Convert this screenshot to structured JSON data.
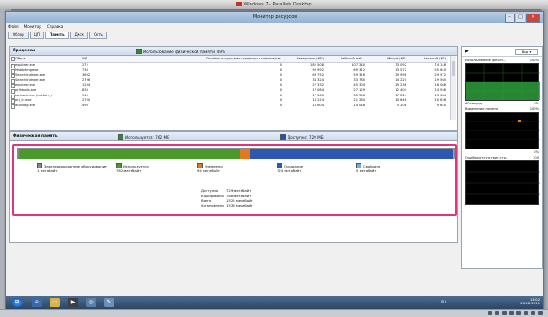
{
  "mac_title": "Windows 7 - Parallels Desktop",
  "window": {
    "title": "Монитор ресурсов",
    "menu": [
      "Файл",
      "Монитор",
      "Справка"
    ],
    "tabs": [
      "Обзор",
      "ЦП",
      "Память",
      "Диск",
      "Сеть"
    ],
    "active_tab": "Память"
  },
  "processes": {
    "title": "Процессы",
    "summary": "Использование физической памяти: 49%",
    "summary_color": "#2e8b2e",
    "columns": [
      "Образ",
      "ИД...",
      "Ошибок отсутствия страницы в памяти/сек.",
      "Завершено (КБ)",
      "Рабочий наб...",
      "Общий (КБ)",
      "Частный (КБ)"
    ],
    "rows": [
      {
        "name": "explorer.exe",
        "pid": "272",
        "hf": "0",
        "commit": "182 508",
        "ws": "107 240",
        "share": "33 092",
        "priv": "74 148"
      },
      {
        "name": "Msbfpfmg.exe",
        "pid": "736",
        "hf": "0",
        "commit": "99 992",
        "ws": "69 312",
        "share": "13 572",
        "priv": "55 640"
      },
      {
        "name": "SearchIndexer.exe",
        "pid": "3692",
        "hf": "0",
        "commit": "69 752",
        "ws": "59 316",
        "share": "29 996",
        "priv": "29 572"
      },
      {
        "name": "SearchIndexer.exe",
        "pid": "2796",
        "hf": "0",
        "commit": "34 324",
        "ws": "33 780",
        "share": "14 220",
        "priv": "19 560"
      },
      {
        "name": "explorer.exe",
        "pid": "1264",
        "hf": "0",
        "commit": "27 332",
        "ws": "45 304",
        "share": "29 236",
        "priv": "16 068"
      },
      {
        "name": "prlhtools.exe",
        "pid": "836",
        "hf": "0",
        "commit": "17 064",
        "ws": "27 129",
        "share": "12 404",
        "priv": "14 936"
      },
      {
        "name": "lsclnsch.exe (trattorry)",
        "pid": "940",
        "hf": "0",
        "commit": "17 360",
        "ws": "30 536",
        "share": "17 224",
        "priv": "13 584"
      },
      {
        "name": "prl_tc.exe",
        "pid": "2700",
        "hf": "0",
        "commit": "13 224",
        "ws": "21 284",
        "share": "10 648",
        "priv": "10 636"
      },
      {
        "name": "audiodg.exe",
        "pid": "496",
        "hf": "0",
        "commit": "14 604",
        "ws": "14 048",
        "share": "5 208",
        "priv": "9 640"
      }
    ]
  },
  "physical": {
    "title": "Физическая память",
    "used_label": "Используется: 762 МБ",
    "avail_label": "Доступно: 729 МБ",
    "used_color": "#2e8b2e",
    "avail_color": "#1e4fb4",
    "bar_fractions": [
      {
        "name": "reserved",
        "fraction": 0.002,
        "color": "#8a8a8a"
      },
      {
        "name": "in-use",
        "fraction": 0.507,
        "color": "#4a9a2a"
      },
      {
        "name": "modified",
        "fraction": 0.023,
        "color": "#e2781f"
      },
      {
        "name": "standby",
        "fraction": 0.467,
        "color": "#2c58b4"
      },
      {
        "name": "free",
        "fraction": 0.001,
        "color": "#6ab0e6"
      }
    ],
    "legend": [
      {
        "label": "Зарезервированное оборудование",
        "value": "1 мегабайт",
        "color": "#8a8a8a"
      },
      {
        "label": "Используется",
        "value": "762 мегабайт",
        "color": "#4a9a2a"
      },
      {
        "label": "Изменено",
        "value": "94 мегабайт",
        "color": "#e2781f"
      },
      {
        "label": "Ожидание",
        "value": "724 мегабайт",
        "color": "#2c58b4"
      },
      {
        "label": "Свободно",
        "value": "5 мегабайт",
        "color": "#6ab0e6"
      }
    ],
    "info": [
      {
        "key": "Доступно",
        "value": "729 мегабайт"
      },
      {
        "key": "Кэшировано",
        "value": "768 мегабайт"
      },
      {
        "key": "Всего",
        "value": "1525 мегабайт"
      },
      {
        "key": "Установлено",
        "value": "1536 мегабайт"
      }
    ]
  },
  "right_pane": {
    "view_label": "Вид",
    "graph1_title": "Использование физич...",
    "graph1_pct": "100%",
    "graph1_foot_left": "60 секунд",
    "graph1_foot_right": "0%",
    "graph2_title": "Выделение памяти",
    "graph2_pct": "100%",
    "graph2_foot_right": "0%",
    "graph3_title": "Ошибок отсутствия стр...",
    "graph3_pct": "100"
  },
  "taskbar": {
    "lang": "RU",
    "time": "18:02",
    "date": "26.08.2011"
  }
}
